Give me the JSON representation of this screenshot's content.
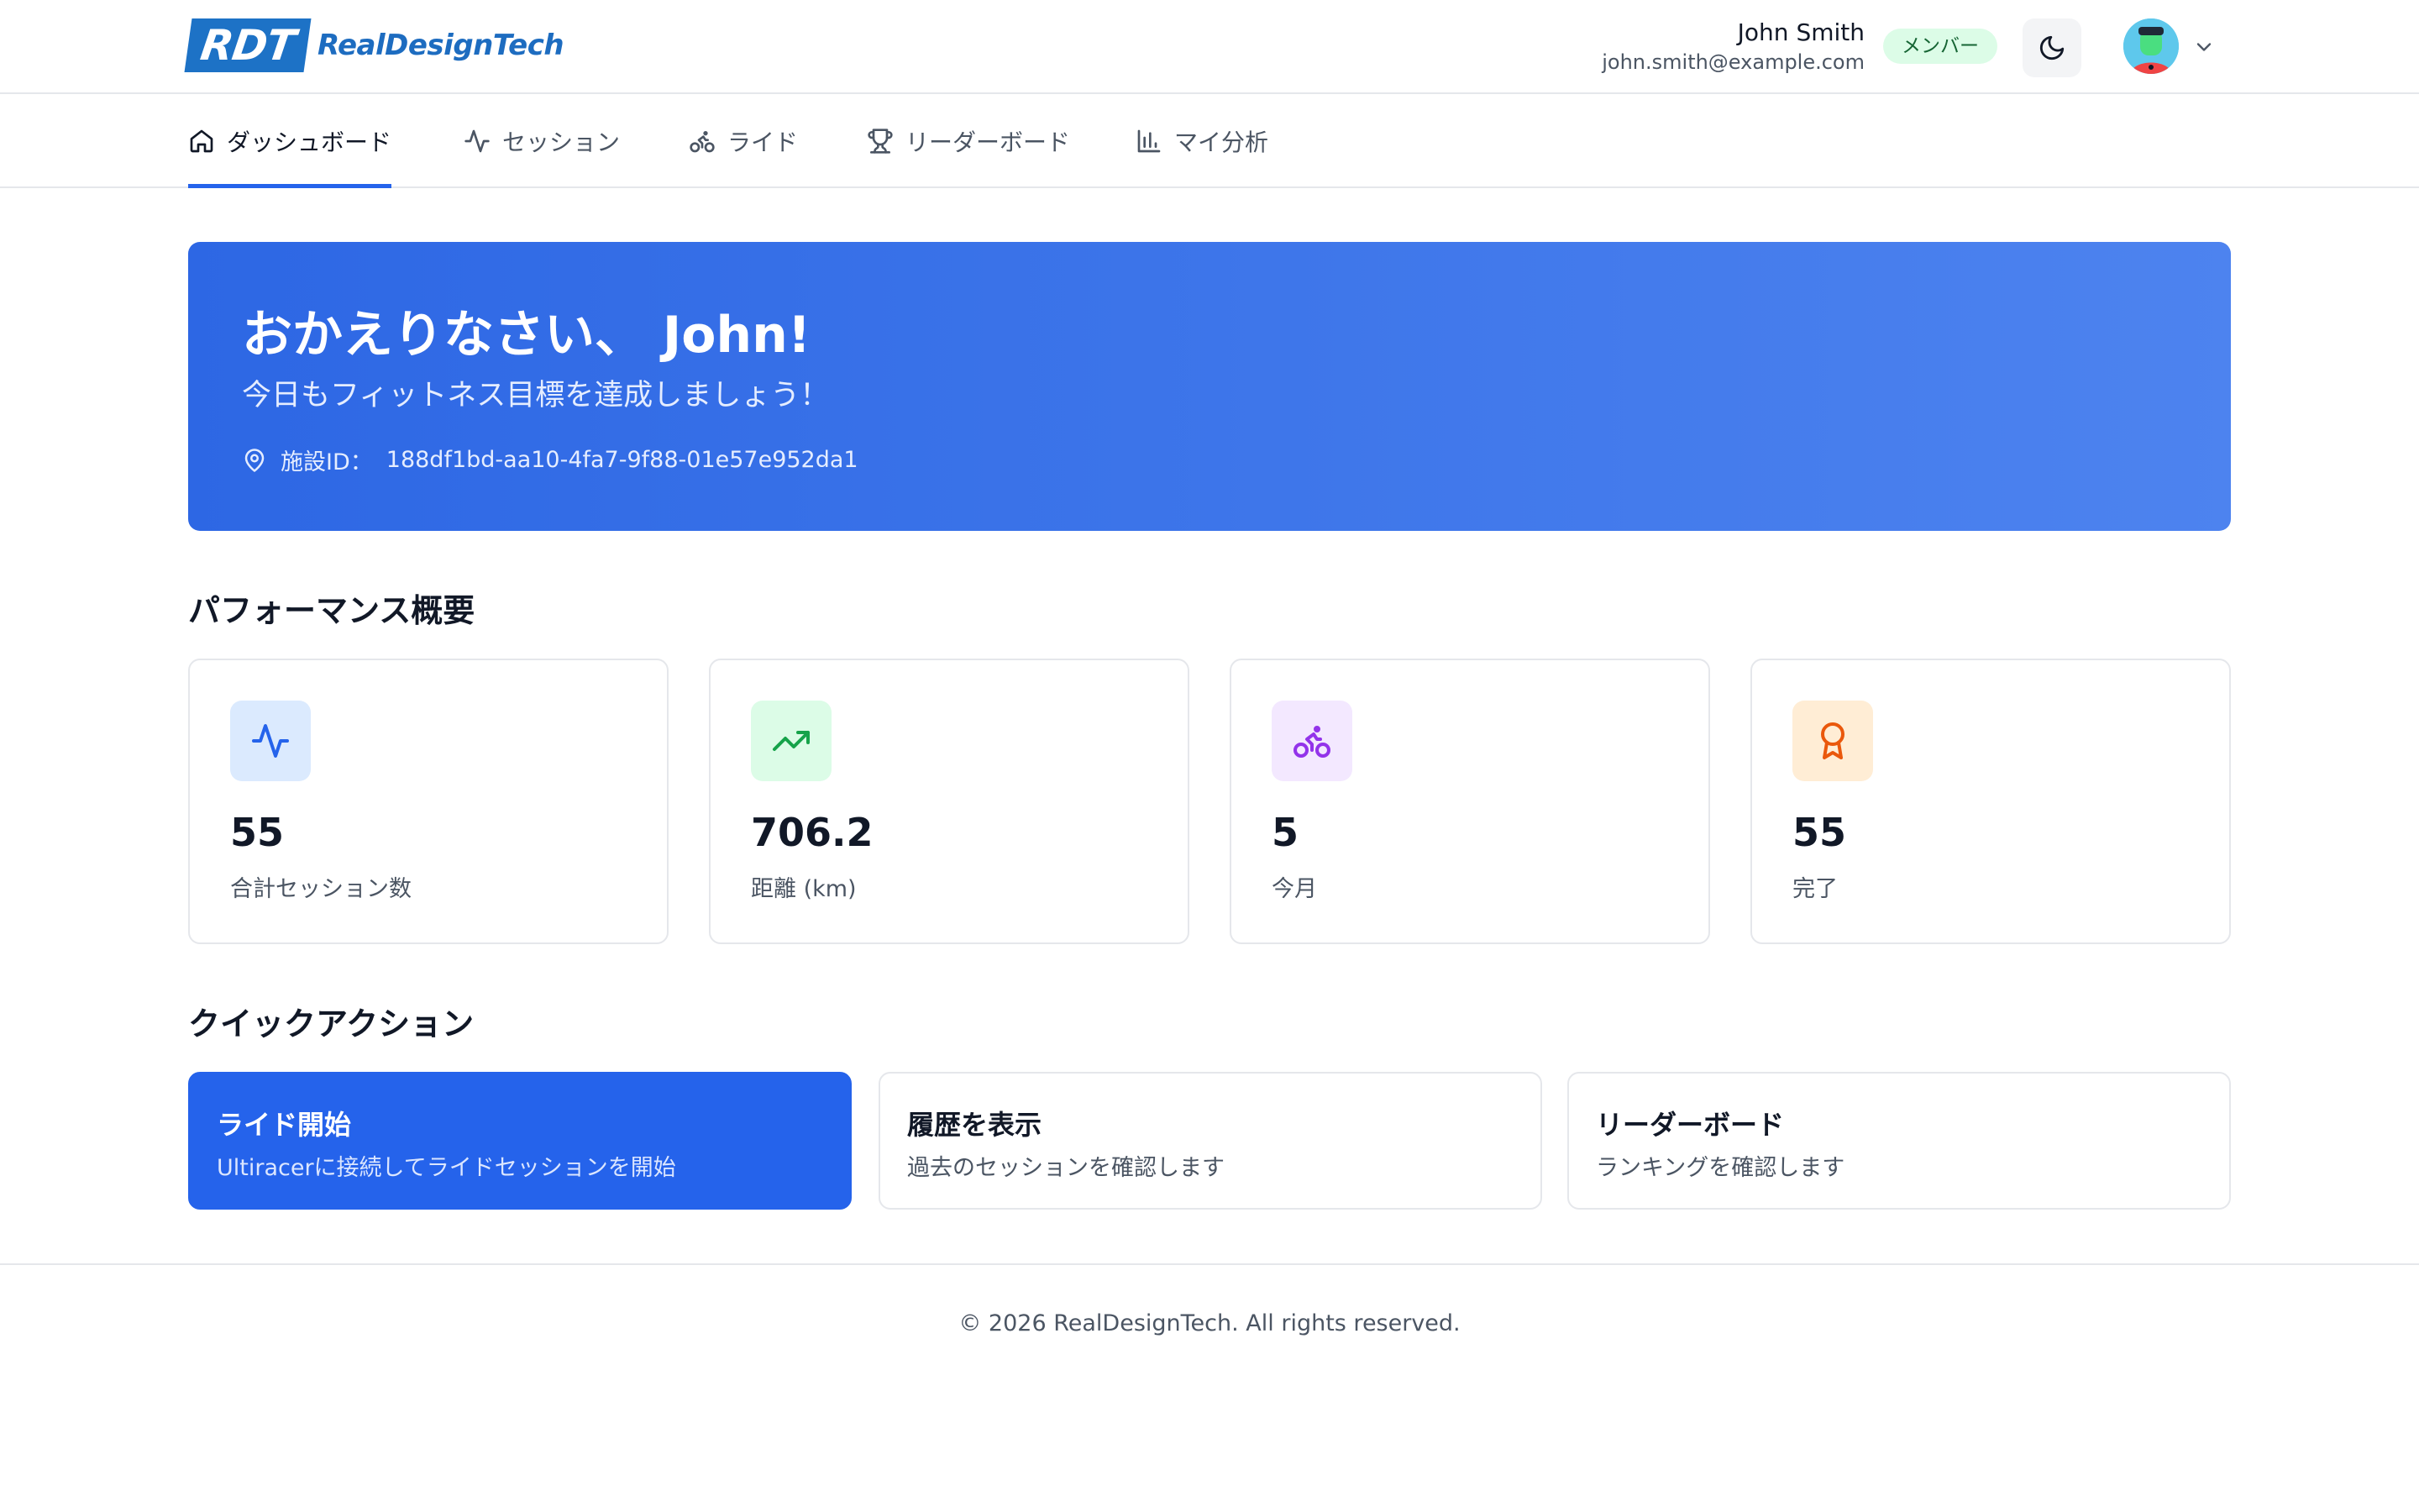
{
  "header": {
    "logo_mark": "RDT",
    "logo_text": "RealDesignTech",
    "user_name": "John Smith",
    "user_email": "john.smith@example.com",
    "role_badge": "メンバー"
  },
  "tabs": [
    {
      "label": "ダッシュボード",
      "icon": "home-icon",
      "active": true
    },
    {
      "label": "セッション",
      "icon": "activity-icon",
      "active": false
    },
    {
      "label": "ライド",
      "icon": "bike-icon",
      "active": false
    },
    {
      "label": "リーダーボード",
      "icon": "trophy-icon",
      "active": false
    },
    {
      "label": "マイ分析",
      "icon": "bar-chart-icon",
      "active": false
    }
  ],
  "hero": {
    "title": "おかえりなさい、 John!",
    "subtitle": "今日もフィットネス目標を達成しましょう！",
    "facility_label": "施設ID：",
    "facility_id": "188df1bd-aa10-4fa7-9f88-01e57e952da1"
  },
  "performance": {
    "title": "パフォーマンス概要",
    "stats": [
      {
        "value": "55",
        "label": "合計セッション数",
        "icon": "activity-icon",
        "icon_color": "#2563eb",
        "bg": "#dbeafe"
      },
      {
        "value": "706.2",
        "label": "距離 (km)",
        "icon": "trending-up-icon",
        "icon_color": "#16a34a",
        "bg": "#dcfce7"
      },
      {
        "value": "5",
        "label": "今月",
        "icon": "bike-icon",
        "icon_color": "#9333ea",
        "bg": "#f3e8ff"
      },
      {
        "value": "55",
        "label": "完了",
        "icon": "award-icon",
        "icon_color": "#ea580c",
        "bg": "#ffedd5"
      }
    ]
  },
  "quick_actions": {
    "title": "クイックアクション",
    "items": [
      {
        "title": "ライド開始",
        "desc": "Ultiracerに接続してライドセッションを開始"
      },
      {
        "title": "履歴を表示",
        "desc": "過去のセッションを確認します"
      },
      {
        "title": "リーダーボード",
        "desc": "ランキングを確認します"
      }
    ]
  },
  "footer": {
    "copyright": "© 2026 RealDesignTech. All rights reserved."
  },
  "colors": {
    "accent": "#2563eb",
    "badge_bg": "#dcfce7",
    "badge_text": "#166534"
  }
}
